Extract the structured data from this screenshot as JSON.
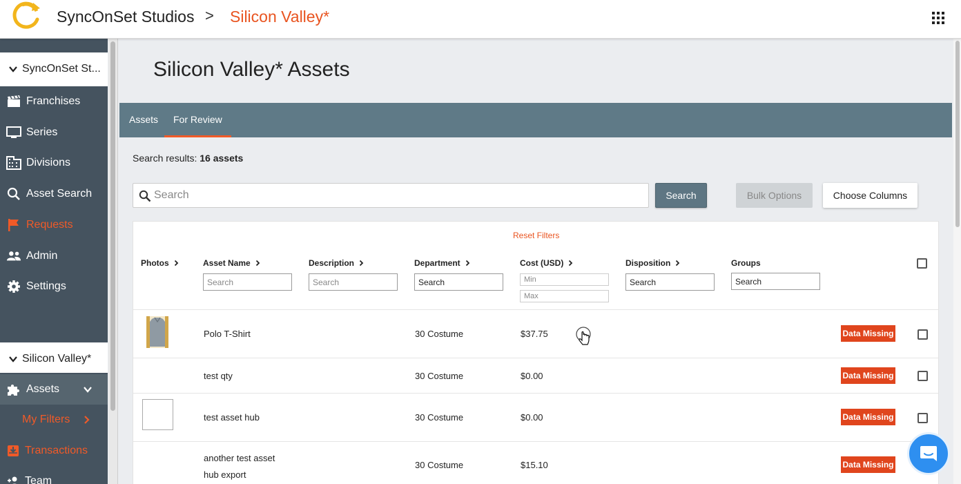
{
  "header": {
    "brand": "SyncOnSet Studios",
    "breadcrumb_separator": ">",
    "current_project": "Silicon Valley*",
    "apps_icon": "grid-icon"
  },
  "sidebar": {
    "org_label": "SyncOnSet St...",
    "items": [
      {
        "label": "Franchises",
        "icon": "clapperboard-icon"
      },
      {
        "label": "Series",
        "icon": "monitor-icon"
      },
      {
        "label": "Divisions",
        "icon": "building-icon"
      },
      {
        "label": "Asset Search",
        "icon": "search-icon"
      },
      {
        "label": "Requests",
        "icon": "flag-icon"
      },
      {
        "label": "Admin",
        "icon": "people-icon"
      },
      {
        "label": "Settings",
        "icon": "gear-icon"
      }
    ],
    "project_label": "Silicon Valley*",
    "assets_label": "Assets",
    "my_filters_label": "My Filters",
    "transactions_label": "Transactions",
    "team_label": "Team"
  },
  "main": {
    "title": "Silicon Valley* Assets",
    "tabs": [
      {
        "label": "Assets"
      },
      {
        "label": "For Review"
      }
    ],
    "results_prefix": "Search results:",
    "results_count": "16 assets",
    "search_placeholder": "Search",
    "search_button": "Search",
    "bulk_button": "Bulk Options",
    "columns_button": "Choose Columns"
  },
  "table": {
    "reset_filters": "Reset Filters",
    "columns": {
      "photos": "Photos",
      "asset_name": "Asset Name",
      "description": "Description",
      "department": "Department",
      "cost": "Cost (USD)",
      "disposition": "Disposition",
      "groups": "Groups"
    },
    "filters": {
      "asset_name": "Search",
      "description": "Search",
      "department": "Search",
      "cost_min": "Min",
      "cost_max": "Max",
      "disposition": "Search",
      "groups": "Search"
    },
    "rows": [
      {
        "name": "Polo T-Shirt",
        "department": "30 Costume",
        "cost": "$37.75",
        "badge": "Data Missing"
      },
      {
        "name": "test qty",
        "department": "30 Costume",
        "cost": "$0.00",
        "badge": "Data Missing"
      },
      {
        "name": "test asset hub",
        "department": "30 Costume",
        "cost": "$0.00",
        "badge": "Data Missing"
      },
      {
        "name_line1": "another test asset",
        "name_line2": "hub export",
        "department": "30 Costume",
        "cost": "$15.10",
        "badge": "Data Missing"
      }
    ]
  },
  "colors": {
    "accent": "#e95420",
    "sidebar": "#45535f",
    "tabbar": "#5f7a87",
    "badge": "#e0451d",
    "chat": "#2e8ff0"
  }
}
